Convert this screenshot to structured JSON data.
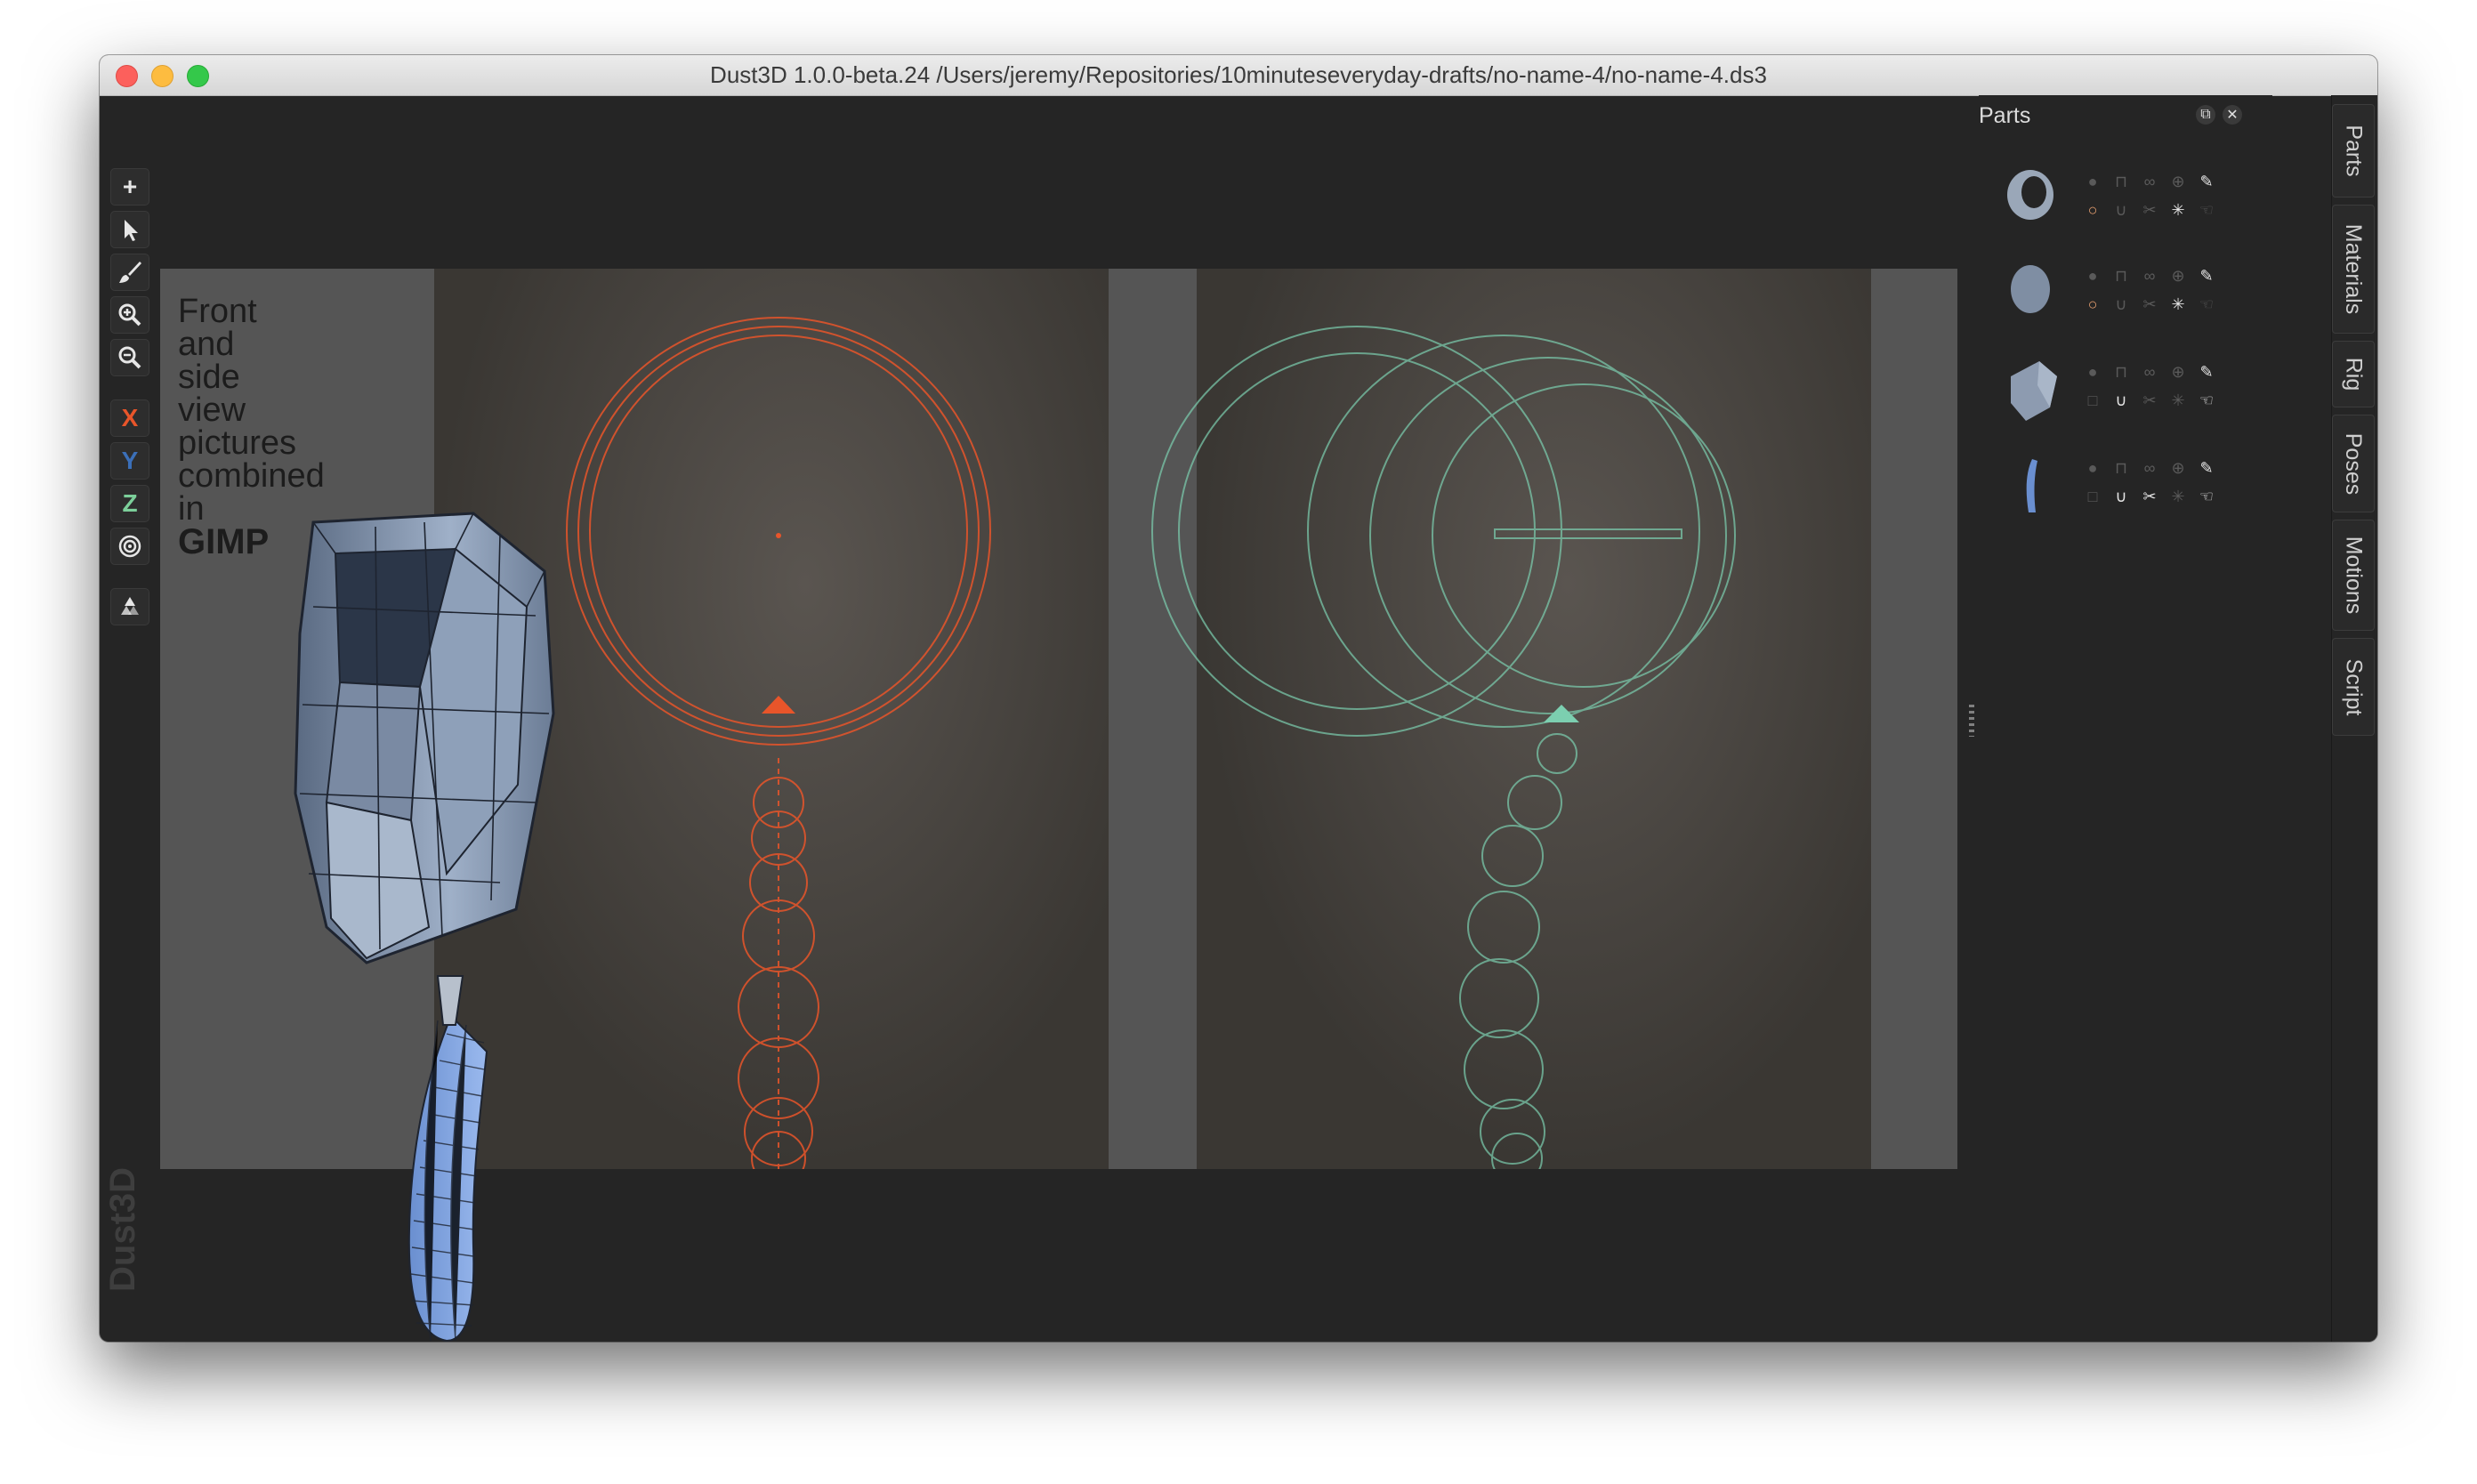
{
  "window": {
    "title": "Dust3D 1.0.0-beta.24 /Users/jeremy/Repositories/10minuteseveryday-drafts/no-name-4/no-name-4.ds3"
  },
  "toolbar": {
    "items": [
      {
        "icon": "plus-icon",
        "label": "+"
      },
      {
        "icon": "pointer-icon",
        "label": ""
      },
      {
        "icon": "brush-icon",
        "label": ""
      },
      {
        "icon": "zoom-in-icon",
        "label": ""
      },
      {
        "icon": "zoom-out-icon",
        "label": ""
      },
      {
        "icon": "x-axis-icon",
        "label": "X",
        "color": "#e8552a"
      },
      {
        "icon": "y-axis-icon",
        "label": "Y",
        "color": "#3b6fb8"
      },
      {
        "icon": "z-axis-icon",
        "label": "Z",
        "color": "#7ccf9a"
      },
      {
        "icon": "radial-icon",
        "label": ""
      },
      {
        "icon": "recycle-icon",
        "label": ""
      }
    ]
  },
  "watermark": "Dust3D",
  "canvas": {
    "caption_lines": [
      "Front",
      "and",
      "side",
      "view",
      "pictures",
      "combined",
      "in"
    ],
    "caption_bold": "GIMP",
    "front_color": "#e8552a",
    "side_color": "#7ccfb0"
  },
  "parts_panel": {
    "title": "Parts",
    "parts": [
      {
        "name": "ring-part",
        "first_icon": "circle-outline-icon",
        "last_icon": "hand-icon"
      },
      {
        "name": "disk-part",
        "first_icon": "circle-outline-icon",
        "last_icon": "hand-icon"
      },
      {
        "name": "cube-part",
        "first_icon": "square-outline-icon",
        "last_icon": "hand-icon"
      },
      {
        "name": "handle-part",
        "first_icon": "square-outline-icon",
        "last_icon": "hand-icon"
      }
    ]
  },
  "tabs": [
    "Parts",
    "Materials",
    "Rig",
    "Poses",
    "Motions",
    "Script"
  ]
}
